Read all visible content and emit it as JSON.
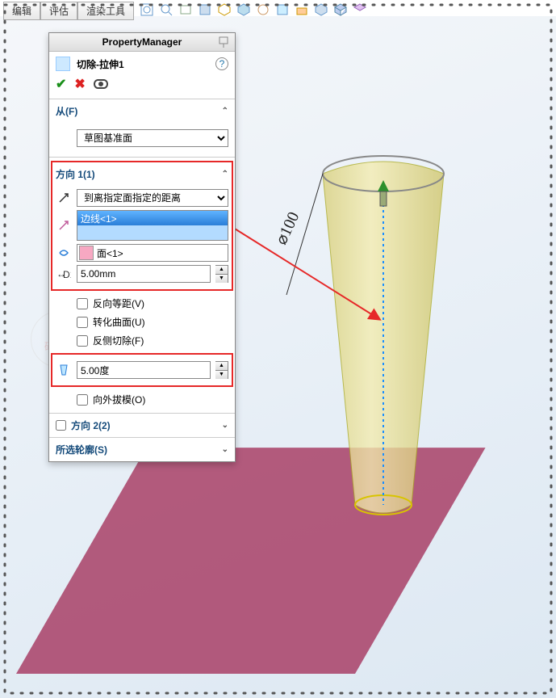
{
  "menubar": {
    "items": [
      "编辑",
      "评估",
      "渲染工具"
    ]
  },
  "panel": {
    "title": "PropertyManager",
    "feature_name": "切除-拉伸1",
    "help_symbol": "?",
    "from": {
      "label": "从(F)",
      "option": "草图基准面"
    },
    "dir1": {
      "label": "方向 1(1)",
      "end_condition": "到离指定面指定的距离",
      "selection": "边线<1>",
      "face": "面<1>",
      "offset_value": "5.00mm",
      "chk_reverse_offset": "反向等距(V)",
      "chk_translate_surface": "转化曲面(U)",
      "chk_reverse_cut": "反侧切除(F)",
      "draft_value": "5.00度",
      "chk_draft_outward": "向外拔模(O)"
    },
    "dir2": {
      "label": "方向 2(2)"
    },
    "selcontour": {
      "label": "所选轮廓(S)"
    }
  },
  "annotation": {
    "diameter": "⌀100"
  },
  "watermark": {
    "l1": "SW",
    "l2": "研习社"
  }
}
